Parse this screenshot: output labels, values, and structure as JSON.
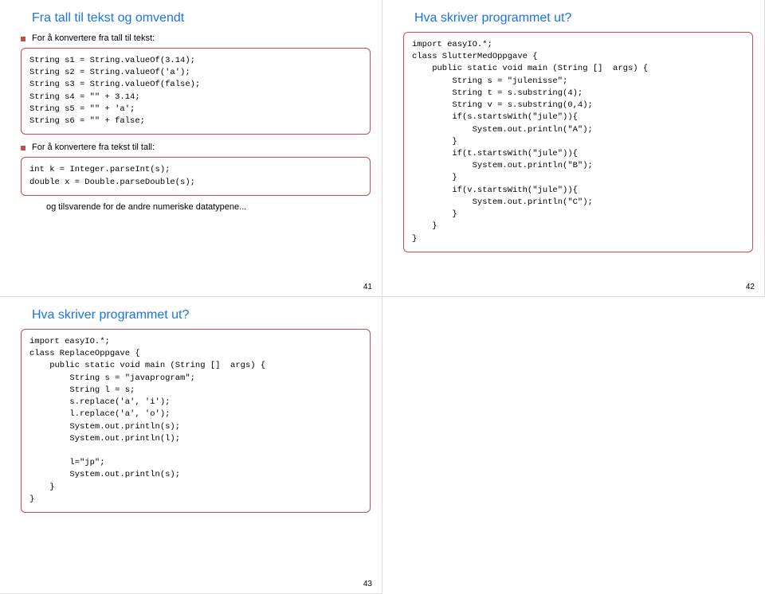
{
  "slides": {
    "s41": {
      "title": "Fra tall til tekst og omvendt",
      "bullet1": "For å konvertere fra tall til tekst:",
      "code1": "String s1 = String.valueOf(3.14);\nString s2 = String.valueOf('a');\nString s3 = String.valueOf(false);\nString s4 = \"\" + 3.14;\nString s5 = \"\" + 'a';\nString s6 = \"\" + false;",
      "bullet2": "For å konvertere fra tekst til tall:",
      "code2": "int k = Integer.parseInt(s);\ndouble x = Double.parseDouble(s);",
      "note": "og tilsvarende for de andre numeriske datatypene...",
      "page": "41"
    },
    "s42": {
      "title": "Hva skriver programmet ut?",
      "code": "import easyIO.*;\nclass SlutterMedOppgave {\n    public static void main (String []  args) {\n        String s = \"julenisse\";\n        String t = s.substring(4);\n        String v = s.substring(0,4);\n        if(s.startsWith(\"jule\")){\n            System.out.println(\"A\");\n        }\n        if(t.startsWith(\"jule\")){\n            System.out.println(\"B\");\n        }\n        if(v.startsWith(\"jule\")){\n            System.out.println(\"C\");\n        }\n    }\n}",
      "page": "42"
    },
    "s43": {
      "title": "Hva skriver programmet ut?",
      "code": "import easyIO.*;\nclass ReplaceOppgave {\n    public static void main (String []  args) {\n        String s = \"javaprogram\";\n        String l = s;\n        s.replace('a', 'i');\n        l.replace('a', 'o');\n        System.out.println(s);\n        System.out.println(l);\n\n        l=\"jp\";\n        System.out.println(s);\n    }\n}",
      "page": "43"
    }
  }
}
